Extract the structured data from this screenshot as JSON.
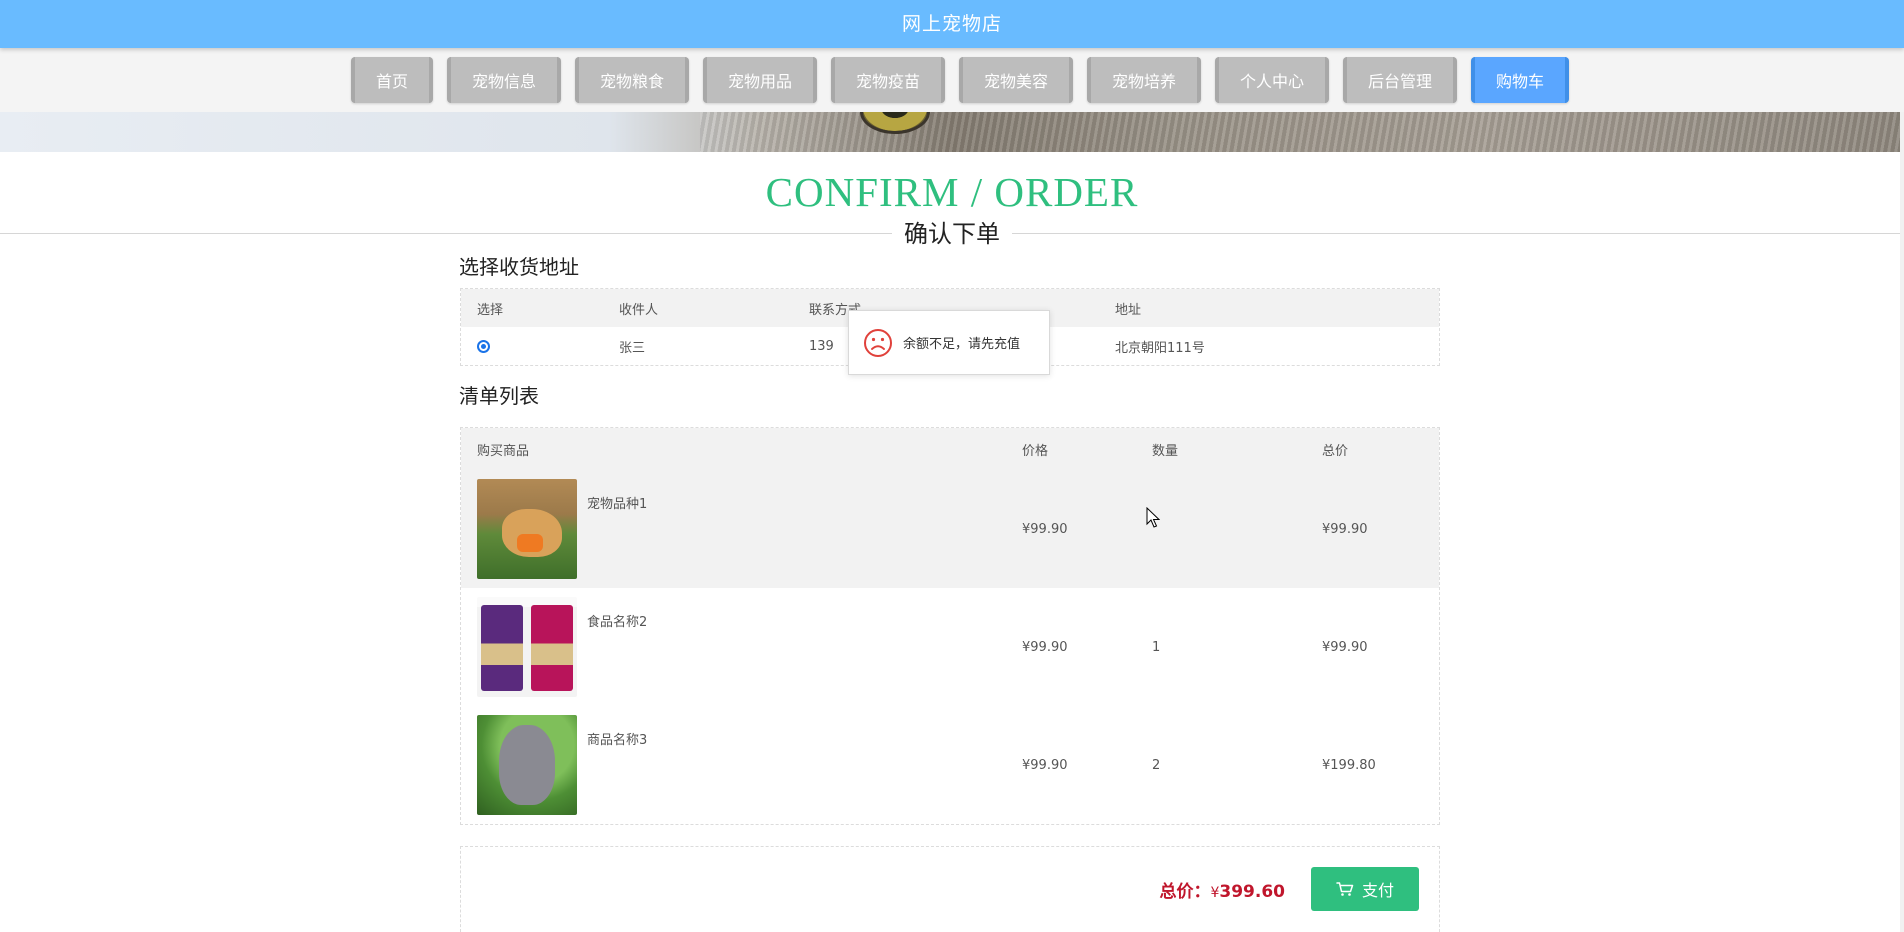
{
  "site": {
    "title": "网上宠物店"
  },
  "nav": {
    "items": [
      {
        "label": "首页",
        "width": 82
      },
      {
        "label": "宠物信息",
        "width": 114
      },
      {
        "label": "宠物粮食",
        "width": 114
      },
      {
        "label": "宠物用品",
        "width": 114
      },
      {
        "label": "宠物疫苗",
        "width": 114
      },
      {
        "label": "宠物美容",
        "width": 114
      },
      {
        "label": "宠物培养",
        "width": 114
      },
      {
        "label": "个人中心",
        "width": 114
      },
      {
        "label": "后台管理",
        "width": 114
      },
      {
        "label": "购物车",
        "width": 98,
        "active": true
      }
    ]
  },
  "heading": {
    "en": "CONFIRM / ORDER",
    "cn": "确认下单"
  },
  "address": {
    "title": "选择收货地址",
    "columns": [
      "选择",
      "收件人",
      "联系方式",
      "地址"
    ],
    "rows": [
      {
        "selected": true,
        "name": "张三",
        "phone": "139",
        "address": "北京朝阳111号"
      }
    ]
  },
  "cart": {
    "title": "清单列表",
    "columns": [
      "购买商品",
      "价格",
      "数量",
      "总价"
    ],
    "rows": [
      {
        "name": "宠物品种1",
        "price": "¥99.90",
        "qty": "",
        "total": "¥99.90",
        "thumb": "dog",
        "highlight": true
      },
      {
        "name": "食品名称2",
        "price": "¥99.90",
        "qty": "1",
        "total": "¥99.90",
        "thumb": "food",
        "highlight": false
      },
      {
        "name": "商品名称3",
        "price": "¥99.90",
        "qty": "2",
        "total": "¥199.80",
        "thumb": "poodle",
        "highlight": false
      }
    ]
  },
  "checkout": {
    "total_label": "总价：",
    "currency": "¥",
    "total_value": "399.60",
    "pay_label": "支付"
  },
  "toast": {
    "message": "余额不足，请先充值",
    "icon": "sad-face-icon"
  },
  "colors": {
    "header": "#69bbff",
    "accent_green": "#2fbf7f",
    "total_red": "#c0162c",
    "nav_active": "#5aa6ff"
  }
}
